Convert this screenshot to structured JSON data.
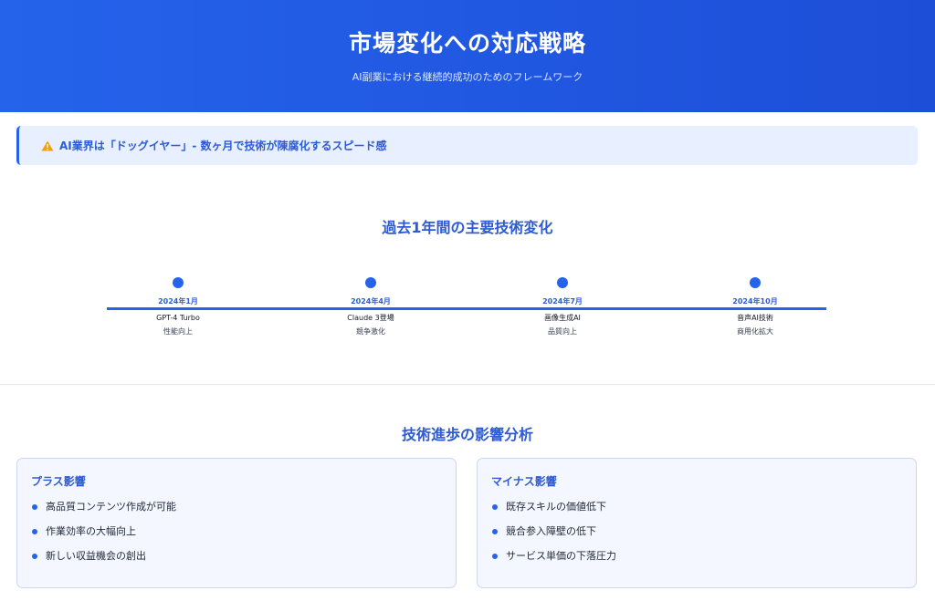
{
  "header": {
    "title": "市場変化への対応戦略",
    "subtitle": "AI副業における継続的成功のためのフレームワーク"
  },
  "alert": {
    "icon": "warning-icon",
    "text": "AI業界は「ドッグイヤー」- 数ヶ月で技術が陳腐化するスピード感"
  },
  "timeline": {
    "title": "過去1年間の主要技術変化",
    "items": [
      {
        "date": "2024年1月",
        "label": "GPT-4 Turbo",
        "sub": "性能向上"
      },
      {
        "date": "2024年4月",
        "label": "Claude 3登場",
        "sub": "競争激化"
      },
      {
        "date": "2024年7月",
        "label": "画像生成AI",
        "sub": "品質向上"
      },
      {
        "date": "2024年10月",
        "label": "音声AI技術",
        "sub": "商用化拡大"
      }
    ]
  },
  "impact": {
    "title": "技術進歩の影響分析",
    "positive": {
      "title": "プラス影響",
      "items": [
        "高品質コンテンツ作成が可能",
        "作業効率の大幅向上",
        "新しい収益機会の創出"
      ]
    },
    "negative": {
      "title": "マイナス影響",
      "items": [
        "既存スキルの価値低下",
        "競合参入障壁の低下",
        "サービス単価の下落圧力"
      ]
    }
  },
  "colors": {
    "primary": "#2563eb",
    "accent_text": "#2d5bd4",
    "alert_bg": "#e8efff",
    "card_bg": "#f4f7ff"
  }
}
